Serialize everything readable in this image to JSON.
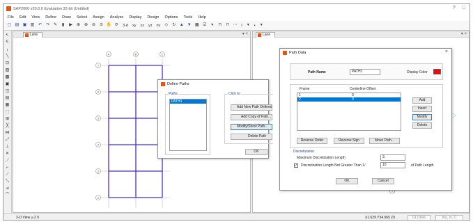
{
  "app": {
    "title": "SAP2000 v20.0.0 Evaluation 32-bit (Untitled)",
    "window_controls": [
      "?",
      "□"
    ]
  },
  "menu": [
    "File",
    "Edit",
    "View",
    "Define",
    "Draw",
    "Select",
    "Assign",
    "Analyze",
    "Display",
    "Design",
    "Options",
    "Tools",
    "Help"
  ],
  "toolbar": {
    "coord_labels": [
      "3-d",
      "xy",
      "xz",
      "yz",
      "nv"
    ],
    "right_labels": [
      "I",
      "▪"
    ]
  },
  "views": {
    "left_tab": "Lane",
    "right_tab": "Lane",
    "tab_controls": "▾ ×"
  },
  "status": {
    "left": "3-D View  ⌀ Z  0",
    "coords": "X1.629  Y34.065  Z0",
    "global": "GLOBAL",
    "units": "Kip, in, C"
  },
  "define_paths": {
    "title": "Define Paths",
    "paths_label": "Paths",
    "paths": [
      "PATH1"
    ],
    "selected": 0,
    "click_label": "Click to:",
    "buttons": {
      "add_new": "Add New Path Defined From...",
      "add_copy": "Add Copy of Path...",
      "modify": "Modify/Show Path...",
      "delete": "Delete Path"
    },
    "ok": "OK"
  },
  "path_data": {
    "title": "Path Data",
    "path_name_label": "Path Name",
    "path_name_value": "PATH1",
    "display_color_label": "Display Color",
    "display_color": "#ff0000",
    "frame_label": "Frame",
    "centerline_label": "Centerline Offset",
    "rows": [
      {
        "frame": "1",
        "offset": "0"
      },
      {
        "frame": "2",
        "offset": "0"
      }
    ],
    "selected_row": 1,
    "side_buttons": {
      "add": "Add",
      "insert": "Insert",
      "modify": "Modify",
      "delete": "Delete"
    },
    "bottom_buttons": {
      "reverse_order": "Reverse Order",
      "reverse_sign": "Reverse Sign",
      "move_path": "Move Path..."
    },
    "discretization_label": "Discretization",
    "max_disc_label": "Maximum Discretization Length",
    "max_disc_value": "3.",
    "disc_length_label": "Discretization Length Not Greater Than 1/",
    "disc_length_value": "10",
    "of_path_length": "of Path Length",
    "ok": "OK",
    "cancel": "Cancel"
  },
  "grid_bubbles": {
    "top": [
      "A",
      "B",
      "C"
    ],
    "left": [
      "7",
      "6",
      "5",
      "4",
      "3",
      "2"
    ],
    "right_view": [
      "1"
    ]
  }
}
